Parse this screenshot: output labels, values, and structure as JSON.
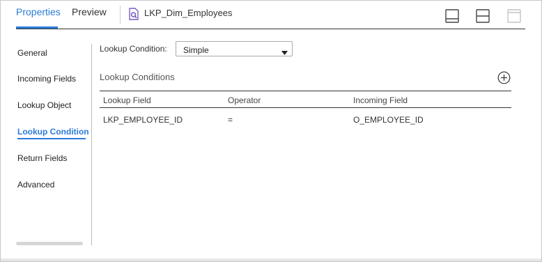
{
  "header": {
    "tabs": [
      {
        "label": "Properties",
        "active": true
      },
      {
        "label": "Preview",
        "active": false
      }
    ],
    "object_name": "LKP_Dim_Employees",
    "object_icon": "lookup-transformation-icon",
    "layout_buttons": [
      "layout-bottom-icon",
      "layout-split-icon",
      "layout-maximize-icon"
    ]
  },
  "sidebar": {
    "items": [
      {
        "label": "General",
        "active": false
      },
      {
        "label": "Incoming Fields",
        "active": false
      },
      {
        "label": "Lookup Object",
        "active": false
      },
      {
        "label": "Lookup Condition",
        "active": true
      },
      {
        "label": "Return Fields",
        "active": false
      },
      {
        "label": "Advanced",
        "active": false
      }
    ]
  },
  "main": {
    "condition_label": "Lookup Condition:",
    "condition_select": {
      "value": "Simple"
    },
    "section_title": "Lookup Conditions",
    "add_icon": "plus-circle-icon",
    "table": {
      "columns": [
        "Lookup Field",
        "Operator",
        "Incoming Field"
      ],
      "rows": [
        [
          "LKP_EMPLOYEE_ID",
          "=",
          "O_EMPLOYEE_ID"
        ]
      ]
    }
  },
  "colors": {
    "accent": "#2c7bd8",
    "icon_purple": "#7b5cc4",
    "border": "#c8c8c8",
    "text": "#333333"
  }
}
